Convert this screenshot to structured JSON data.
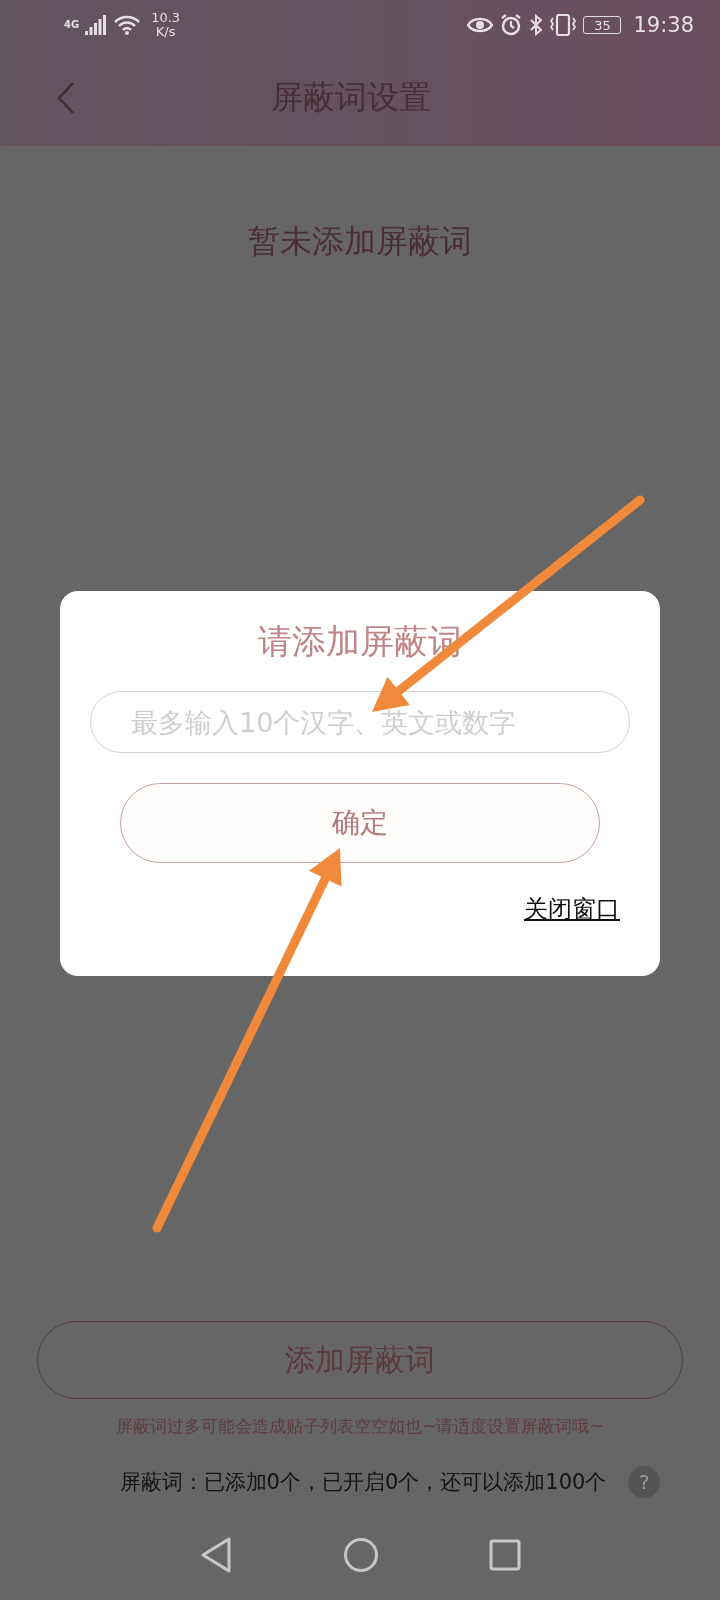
{
  "status_bar": {
    "network": "4G",
    "speed_value": "10.3",
    "speed_unit": "K/s",
    "battery": "35",
    "time": "19:38"
  },
  "header": {
    "title": "屏蔽词设置"
  },
  "empty_message": "暂未添加屏蔽词",
  "add_button": "添加屏蔽词",
  "hint": "屏蔽词过多可能会造成贴子列表空空如也~请适度设置屏蔽词哦~",
  "summary": "屏蔽词：已添加0个，已开启0个，还可以添加100个",
  "help": "?",
  "dialog": {
    "title": "请添加屏蔽词",
    "input": {
      "placeholder": "最多输入10个汉字、英文或数字"
    },
    "confirm": "确定",
    "close": "关闭窗口"
  },
  "annotations": [
    {
      "kind": "arrow"
    },
    {
      "kind": "arrow"
    }
  ]
}
